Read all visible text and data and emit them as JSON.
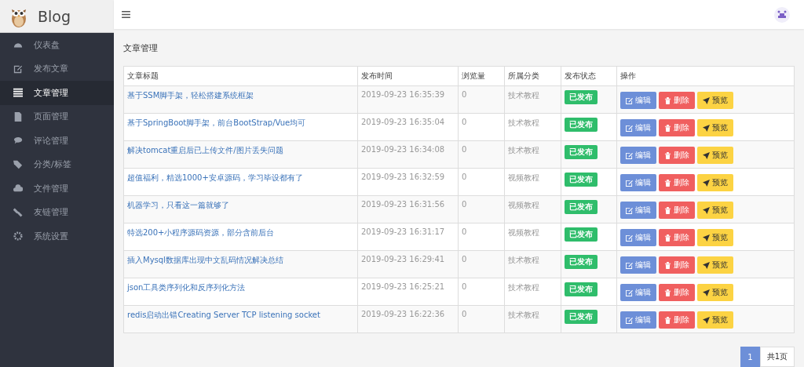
{
  "brand": {
    "name": "Blog"
  },
  "sidebar": {
    "items": [
      {
        "label": "仪表盘",
        "selected": false
      },
      {
        "label": "发布文章",
        "selected": false
      },
      {
        "label": "文章管理",
        "selected": true
      },
      {
        "label": "页面管理",
        "selected": false
      },
      {
        "label": "评论管理",
        "selected": false
      },
      {
        "label": "分类/标签",
        "selected": false
      },
      {
        "label": "文件管理",
        "selected": false
      },
      {
        "label": "友链管理",
        "selected": false
      },
      {
        "label": "系统设置",
        "selected": false
      }
    ]
  },
  "page": {
    "title": "文章管理"
  },
  "table": {
    "columns": [
      "文章标题",
      "发布时间",
      "浏览量",
      "所属分类",
      "发布状态",
      "操作"
    ],
    "rows": [
      {
        "title": "基于SSM脚手架，轻松搭建系统框架",
        "time": "2019-09-23 16:35:39",
        "views": "0",
        "category": "技术教程",
        "status": "已发布",
        "actions": [
          {
            "kind": "edit",
            "label": "编辑"
          },
          {
            "kind": "delete",
            "label": "删除"
          },
          {
            "kind": "preview",
            "label": "预览"
          }
        ]
      },
      {
        "title": "基于SpringBoot脚手架，前台BootStrap/Vue均可",
        "time": "2019-09-23 16:35:04",
        "views": "0",
        "category": "技术教程",
        "status": "已发布",
        "actions": [
          {
            "kind": "edit",
            "label": "编辑"
          },
          {
            "kind": "delete",
            "label": "删除"
          },
          {
            "kind": "preview",
            "label": "预览"
          }
        ]
      },
      {
        "title": "解决tomcat重启后已上传文件/图片丢失问题",
        "time": "2019-09-23 16:34:08",
        "views": "0",
        "category": "技术教程",
        "status": "已发布",
        "actions": [
          {
            "kind": "edit",
            "label": "编辑"
          },
          {
            "kind": "delete",
            "label": "删除"
          },
          {
            "kind": "preview",
            "label": "预览"
          }
        ]
      },
      {
        "title": "超值福利，精选1000+安卓源码，学习毕设都有了",
        "time": "2019-09-23 16:32:59",
        "views": "0",
        "category": "视频教程",
        "status": "已发布",
        "actions": [
          {
            "kind": "edit",
            "label": "编辑"
          },
          {
            "kind": "delete",
            "label": "删除"
          },
          {
            "kind": "preview",
            "label": "预览"
          }
        ]
      },
      {
        "title": "机器学习，只看这一篇就够了",
        "time": "2019-09-23 16:31:56",
        "views": "0",
        "category": "视频教程",
        "status": "已发布",
        "actions": [
          {
            "kind": "edit",
            "label": "编辑"
          },
          {
            "kind": "delete",
            "label": "删除"
          },
          {
            "kind": "preview",
            "label": "预览"
          }
        ]
      },
      {
        "title": "特选200+小程序源码资源，部分含前后台",
        "time": "2019-09-23 16:31:17",
        "views": "0",
        "category": "视频教程",
        "status": "已发布",
        "actions": [
          {
            "kind": "edit",
            "label": "编辑"
          },
          {
            "kind": "delete",
            "label": "删除"
          },
          {
            "kind": "preview",
            "label": "预览"
          }
        ]
      },
      {
        "title": "插入Mysql数据库出现中文乱码情况解决总结",
        "time": "2019-09-23 16:29:41",
        "views": "0",
        "category": "技术教程",
        "status": "已发布",
        "actions": [
          {
            "kind": "edit",
            "label": "编辑"
          },
          {
            "kind": "delete",
            "label": "删除"
          },
          {
            "kind": "preview",
            "label": "预览"
          }
        ]
      },
      {
        "title": "json工具类序列化和反序列化方法",
        "time": "2019-09-23 16:25:21",
        "views": "0",
        "category": "技术教程",
        "status": "已发布",
        "actions": [
          {
            "kind": "edit",
            "label": "编辑"
          },
          {
            "kind": "delete",
            "label": "删除"
          },
          {
            "kind": "preview",
            "label": "预览"
          }
        ]
      },
      {
        "title": "redis启动出错Creating Server TCP listening socket",
        "time": "2019-09-23 16:22:36",
        "views": "0",
        "category": "技术教程",
        "status": "已发布",
        "actions": [
          {
            "kind": "edit",
            "label": "编辑"
          },
          {
            "kind": "delete",
            "label": "删除"
          },
          {
            "kind": "preview",
            "label": "预览"
          }
        ]
      }
    ]
  },
  "pagination": {
    "pages": [
      {
        "label": "1",
        "selected": true
      }
    ],
    "summary": "共1页"
  }
}
